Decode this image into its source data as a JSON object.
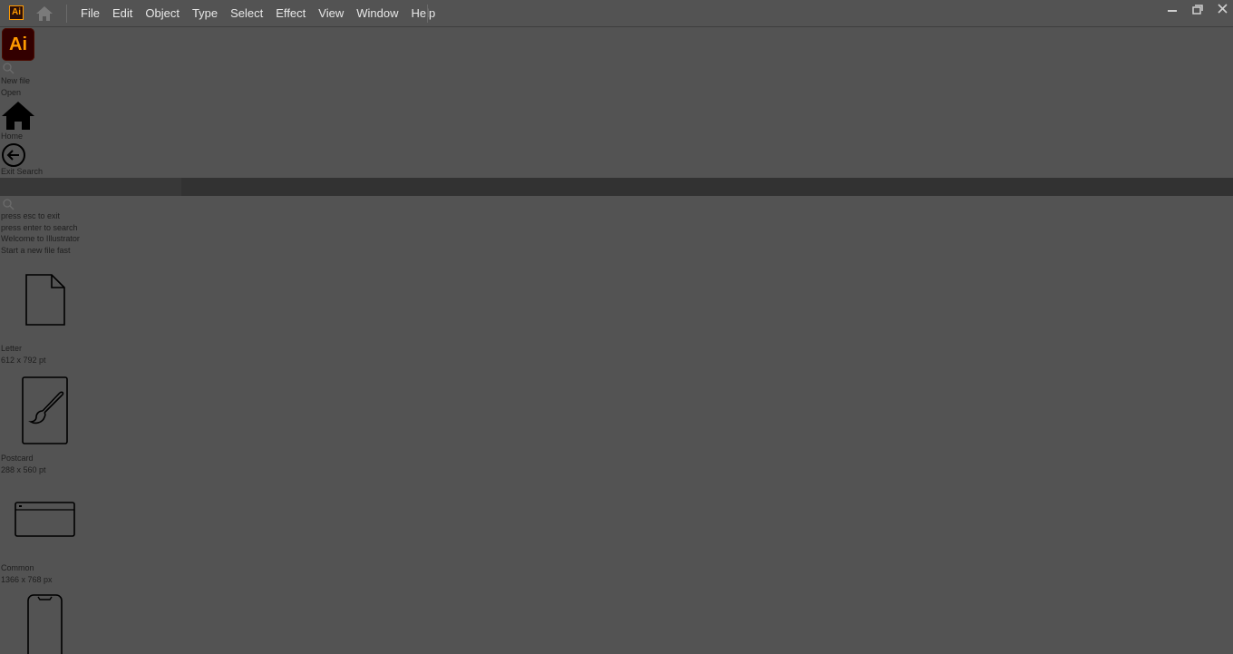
{
  "titlebar": {
    "app_badge": "Ai",
    "menu": [
      "File",
      "Edit",
      "Object",
      "Type",
      "Select",
      "Effect",
      "View",
      "Window",
      "Help"
    ],
    "window_controls": [
      "minimize-icon",
      "restore-icon",
      "close-icon"
    ]
  },
  "sidebar": {
    "logo_text": "Ai",
    "new_file": "New file",
    "open": "Open",
    "home": "Home",
    "exit_search": "Exit Search"
  },
  "search": {
    "placeholder": "",
    "hint_exit": "press esc to exit",
    "hint_enter": "press enter to search"
  },
  "welcome": {
    "title": "Welcome to Illustrator",
    "subtitle": "Start a new file fast"
  },
  "presets": [
    {
      "name": "Letter",
      "size": "612 x 792 pt",
      "icon": "document-icon"
    },
    {
      "name": "Postcard",
      "size": "288 x 560 pt",
      "icon": "brush-document-icon"
    },
    {
      "name": "Common",
      "size": "1366 x 768 px",
      "icon": "browser-window-icon"
    },
    {
      "name": "",
      "size": "",
      "icon": "mobile-phone-icon"
    }
  ],
  "colors": {
    "background": "#535353",
    "search_bar": "#323232",
    "brand": "#ff9a00",
    "brand_bg": "#330000"
  }
}
